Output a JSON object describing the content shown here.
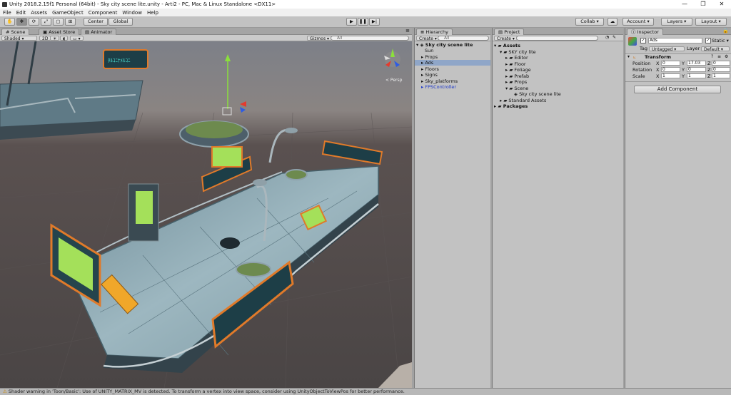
{
  "window": {
    "title": "Unity 2018.2.15f1 Personal (64bit) - Sky city scene lite.unity - Arti2 - PC, Mac & Linux Standalone <DX11>",
    "min": "—",
    "max": "❐",
    "close": "✕"
  },
  "menu": [
    "File",
    "Edit",
    "Assets",
    "GameObject",
    "Component",
    "Window",
    "Help"
  ],
  "toolbar": {
    "pivot": "Center",
    "space": "Global",
    "collab": "Collab ▾",
    "account": "Account ▾",
    "layers": "Layers ▾",
    "layout": "Layout ▾",
    "play": "▶",
    "pause": "❚❚",
    "step": "▶|"
  },
  "scene": {
    "tabs": [
      "Scene",
      "Asset Store",
      "Animator"
    ],
    "shading": "Shaded",
    "mode2d": "2D",
    "gizmos": "Gizmos ▾",
    "search_placeholder": "All",
    "persp": "< Persp",
    "sign_text": "ﾀﾙｺﾆﾅﾒﾙｺﾆ"
  },
  "hierarchy": {
    "tab": "Hierarchy",
    "create": "Create ▾",
    "search_placeholder": "All",
    "scene": "Sky city scene lite",
    "items": [
      "Sun",
      "Props",
      "Ads",
      "Floors",
      "Signs",
      "Sky_platforms",
      "FPSController"
    ]
  },
  "project": {
    "tab": "Project",
    "create": "Create ▾",
    "tree": [
      {
        "label": "Assets",
        "depth": 0,
        "bold": true
      },
      {
        "label": "SKY city lite",
        "depth": 1
      },
      {
        "label": "Editor",
        "depth": 2
      },
      {
        "label": "Floor",
        "depth": 2
      },
      {
        "label": "Foliage",
        "depth": 2
      },
      {
        "label": "Prefab",
        "depth": 2
      },
      {
        "label": "Props",
        "depth": 2
      },
      {
        "label": "Scene",
        "depth": 2
      },
      {
        "label": "Sky city scene lite",
        "depth": 3,
        "file": true
      },
      {
        "label": "Standard Assets",
        "depth": 1
      },
      {
        "label": "Packages",
        "depth": 0,
        "bold": true
      }
    ]
  },
  "inspector": {
    "tab": "Inspector",
    "object_name": "Ads",
    "static_label": "Static",
    "tag_label": "Tag",
    "tag_value": "Untagged",
    "layer_label": "Layer",
    "layer_value": "Default",
    "transform": "Transform",
    "position_label": "Position",
    "rotation_label": "Rotation",
    "scale_label": "Scale",
    "position": {
      "x": "0",
      "y": "17.03",
      "z": "0"
    },
    "rotation": {
      "x": "0",
      "y": "0",
      "z": "0"
    },
    "scale": {
      "x": "1",
      "y": "1",
      "z": "1"
    },
    "add_component": "Add Component"
  },
  "status": "Shader warning in 'Toon/Basic': Use of UNITY_MATRIX_MV is detected. To transform a vertex into view space, consider using UnityObjectToViewPos for better performance.",
  "colors": {
    "sky_top": "#7a7e86",
    "ground": "#4a4444",
    "selection": "#8fa6c8",
    "prefab_blue": "#1f39c9",
    "neon": "#49e3d5",
    "orange_trim": "#e07a2a"
  }
}
